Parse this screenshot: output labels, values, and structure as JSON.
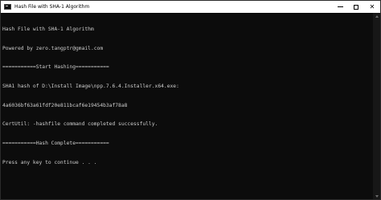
{
  "window": {
    "title": "Hash File with SHA-1 Algorithm"
  },
  "controls": {
    "minimize": "minimize-icon",
    "maximize": "maximize-icon",
    "close_glyph": "✕"
  },
  "console": {
    "lines": [
      "Hash File with SHA-1 Algorithm",
      "Powered by zero.tangptr@gmail.com",
      "===========Start Hashing===========",
      "SHA1 hash of D:\\Install Image\\npp.7.6.4.Installer.x64.exe:",
      "4a6036bf63a61fdf20e811bcaf6e19454b3af78a8",
      "CertUtil: -hashfile command completed successfully.",
      "===========Hash Complete===========",
      "Press any key to continue . . ."
    ]
  },
  "colors": {
    "background": "#0c0c0c",
    "text": "#cccccc",
    "titlebar": "#ffffff"
  }
}
